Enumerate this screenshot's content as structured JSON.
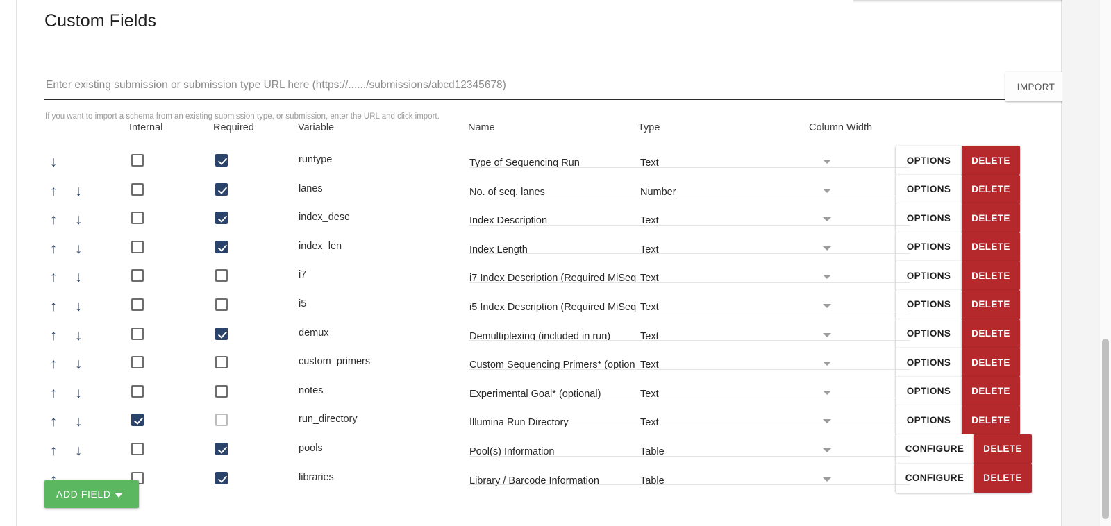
{
  "page": {
    "title": "Custom Fields"
  },
  "import": {
    "placeholder": "Enter existing submission or submission type URL here (https://....../submissions/abcd12345678)",
    "value": "",
    "button_label": "IMPORT",
    "hint": "If you want to import a schema from an existing submission type, or submission, enter the URL and click import."
  },
  "table": {
    "headers": {
      "internal": "Internal",
      "required": "Required",
      "variable": "Variable",
      "name": "Name",
      "type": "Type",
      "column_width": "Column Width"
    },
    "rows": [
      {
        "variable": "runtype",
        "name": "Type of Sequencing Run",
        "type": "Text",
        "internal": false,
        "required": true,
        "action": "OPTIONS",
        "delete": "DELETE",
        "up": false,
        "down": true
      },
      {
        "variable": "lanes",
        "name": "No. of seq. lanes",
        "type": "Number",
        "internal": false,
        "required": true,
        "action": "OPTIONS",
        "delete": "DELETE",
        "up": true,
        "down": true
      },
      {
        "variable": "index_desc",
        "name": "Index Description",
        "type": "Text",
        "internal": false,
        "required": true,
        "action": "OPTIONS",
        "delete": "DELETE",
        "up": true,
        "down": true
      },
      {
        "variable": "index_len",
        "name": "Index Length",
        "type": "Text",
        "internal": false,
        "required": true,
        "action": "OPTIONS",
        "delete": "DELETE",
        "up": true,
        "down": true
      },
      {
        "variable": "i7",
        "name": "i7 Index Description (Required MiSeq",
        "type": "Text",
        "internal": false,
        "required": false,
        "action": "OPTIONS",
        "delete": "DELETE",
        "up": true,
        "down": true
      },
      {
        "variable": "i5",
        "name": "i5 Index Description  (Required MiSeq",
        "type": "Text",
        "internal": false,
        "required": false,
        "action": "OPTIONS",
        "delete": "DELETE",
        "up": true,
        "down": true
      },
      {
        "variable": "demux",
        "name": "Demultiplexing (included in run)",
        "type": "Text",
        "internal": false,
        "required": true,
        "action": "OPTIONS",
        "delete": "DELETE",
        "up": true,
        "down": true
      },
      {
        "variable": "custom_primers",
        "name": "Custom Sequencing Primers* (option",
        "type": "Text",
        "internal": false,
        "required": false,
        "action": "OPTIONS",
        "delete": "DELETE",
        "up": true,
        "down": true
      },
      {
        "variable": "notes",
        "name": "Experimental Goal* (optional)",
        "type": "Text",
        "internal": false,
        "required": false,
        "action": "OPTIONS",
        "delete": "DELETE",
        "up": true,
        "down": true
      },
      {
        "variable": "run_directory",
        "name": "Illumina Run Directory",
        "type": "Text",
        "internal": true,
        "required": false,
        "action": "OPTIONS",
        "delete": "DELETE",
        "up": true,
        "down": true
      },
      {
        "variable": "pools",
        "name": "Pool(s) Information",
        "type": "Table",
        "internal": false,
        "required": true,
        "action": "CONFIGURE",
        "delete": "DELETE",
        "up": true,
        "down": true
      },
      {
        "variable": "libraries",
        "name": "Library / Barcode Information",
        "type": "Table",
        "internal": false,
        "required": true,
        "action": "CONFIGURE",
        "delete": "DELETE",
        "up": true,
        "down": false
      }
    ]
  },
  "footer": {
    "add_field_label": "ADD FIELD"
  },
  "colors": {
    "checkbox_checked": "#2a436b",
    "delete_red": "#b5292c",
    "add_green": "#5cb860",
    "arrow_navy": "#2e4468"
  },
  "icons": {
    "arrow_up": "↑",
    "arrow_down": "↓"
  }
}
